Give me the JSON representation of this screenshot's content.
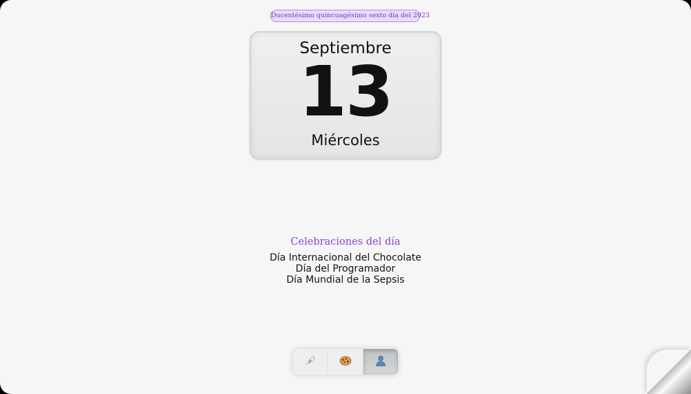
{
  "header": {
    "day_of_year_text": "Ducentésimo quincuagésimo sexto día del 2023"
  },
  "calendar": {
    "month": "Septiembre",
    "day": "13",
    "weekday": "Miércoles"
  },
  "celebrations": {
    "title": "Celebraciones del día",
    "items": [
      "Día Internacional del Chocolate",
      "Día del Programador",
      "Día Mundial de la Sepsis"
    ]
  },
  "tabs": [
    {
      "icon": "syringe-icon",
      "active": false
    },
    {
      "icon": "cookie-icon",
      "active": false
    },
    {
      "icon": "person-icon",
      "active": true
    }
  ],
  "colors": {
    "accent": "#8d42d8",
    "badge_background": "#e9dcfb",
    "page_background": "#f6f6f6"
  }
}
